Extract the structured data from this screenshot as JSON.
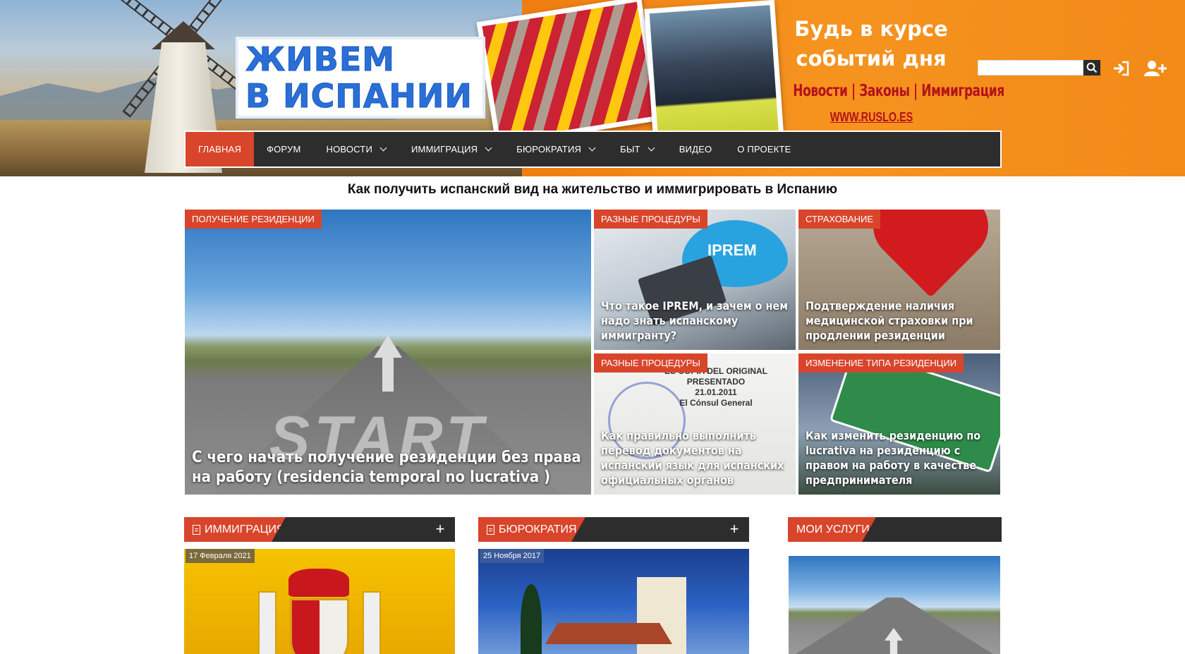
{
  "header": {
    "logo_line1": "ЖИВЕМ",
    "logo_line2": "В ИСПАНИИ",
    "promo_title_line1": "Будь в курсе",
    "promo_title_line2": "событий дня",
    "promo_sub": "Новости | Законы | Иммиграция",
    "promo_url": "WWW.RUSLO.ES",
    "search_placeholder": "",
    "icons": [
      "search-icon",
      "login-icon",
      "register-icon"
    ]
  },
  "nav": {
    "items": [
      {
        "label": "ГЛАВНАЯ",
        "active": true,
        "has_dropdown": false
      },
      {
        "label": "ФОРУМ",
        "active": false,
        "has_dropdown": false
      },
      {
        "label": "НОВОСТИ",
        "active": false,
        "has_dropdown": true
      },
      {
        "label": "ИММИГРАЦИЯ",
        "active": false,
        "has_dropdown": true
      },
      {
        "label": "БЮРОКРАТИЯ",
        "active": false,
        "has_dropdown": true
      },
      {
        "label": "БЫТ",
        "active": false,
        "has_dropdown": true
      },
      {
        "label": "ВИДЕО",
        "active": false,
        "has_dropdown": false
      },
      {
        "label": "О ПРОЕКТЕ",
        "active": false,
        "has_dropdown": false
      }
    ]
  },
  "subheading": "Как получить испанский вид на жительство и иммигрировать в Испанию",
  "featured": [
    {
      "category": "ПОЛУЧЕНИЕ РЕЗИДЕНЦИИ",
      "title": "С чего начать получение резиденции без права на работу (residencia temporal no lucrativa )",
      "image_text": "START"
    },
    {
      "category": "РАЗНЫЕ ПРОЦЕДУРЫ",
      "title": "Что такое IPREM, и зачем о нем надо знать испанскому иммигранту?",
      "image_text": "IPREM"
    },
    {
      "category": "СТРАХОВАНИЕ",
      "title": "Подтверждение наличия медицинской страховки при продлении резиденции"
    },
    {
      "category": "РАЗНЫЕ ПРОЦЕДУРЫ",
      "title": "Как правильно выполнить перевод документов на испанский язык для испанских официальных органов",
      "image_text": "ES COPIA DEL ORIGINAL\nPRESENTADO\n21.01.2011\nEl Cónsul General"
    },
    {
      "category": "ИЗМЕНЕНИЕ ТИПА РЕЗИДЕНЦИИ",
      "title": "Как изменить резиденцию по lucrativa на резиденцию с правом на работу в качестве предпринимателя"
    }
  ],
  "columns": [
    {
      "heading": "ИММИГРАЦИЯ",
      "date": "17 Февраля 2021",
      "icon": "document-icon"
    },
    {
      "heading": "БЮРОКРАТИЯ",
      "date": "25 Ноября 2017",
      "icon": "document-icon"
    },
    {
      "heading": "МОИ УСЛУГИ"
    }
  ],
  "colors": {
    "accent": "#d8452b",
    "nav_bg": "#2d2d2d",
    "banner_orange": "#f6931f",
    "logo_blue": "#2a6fd6"
  }
}
